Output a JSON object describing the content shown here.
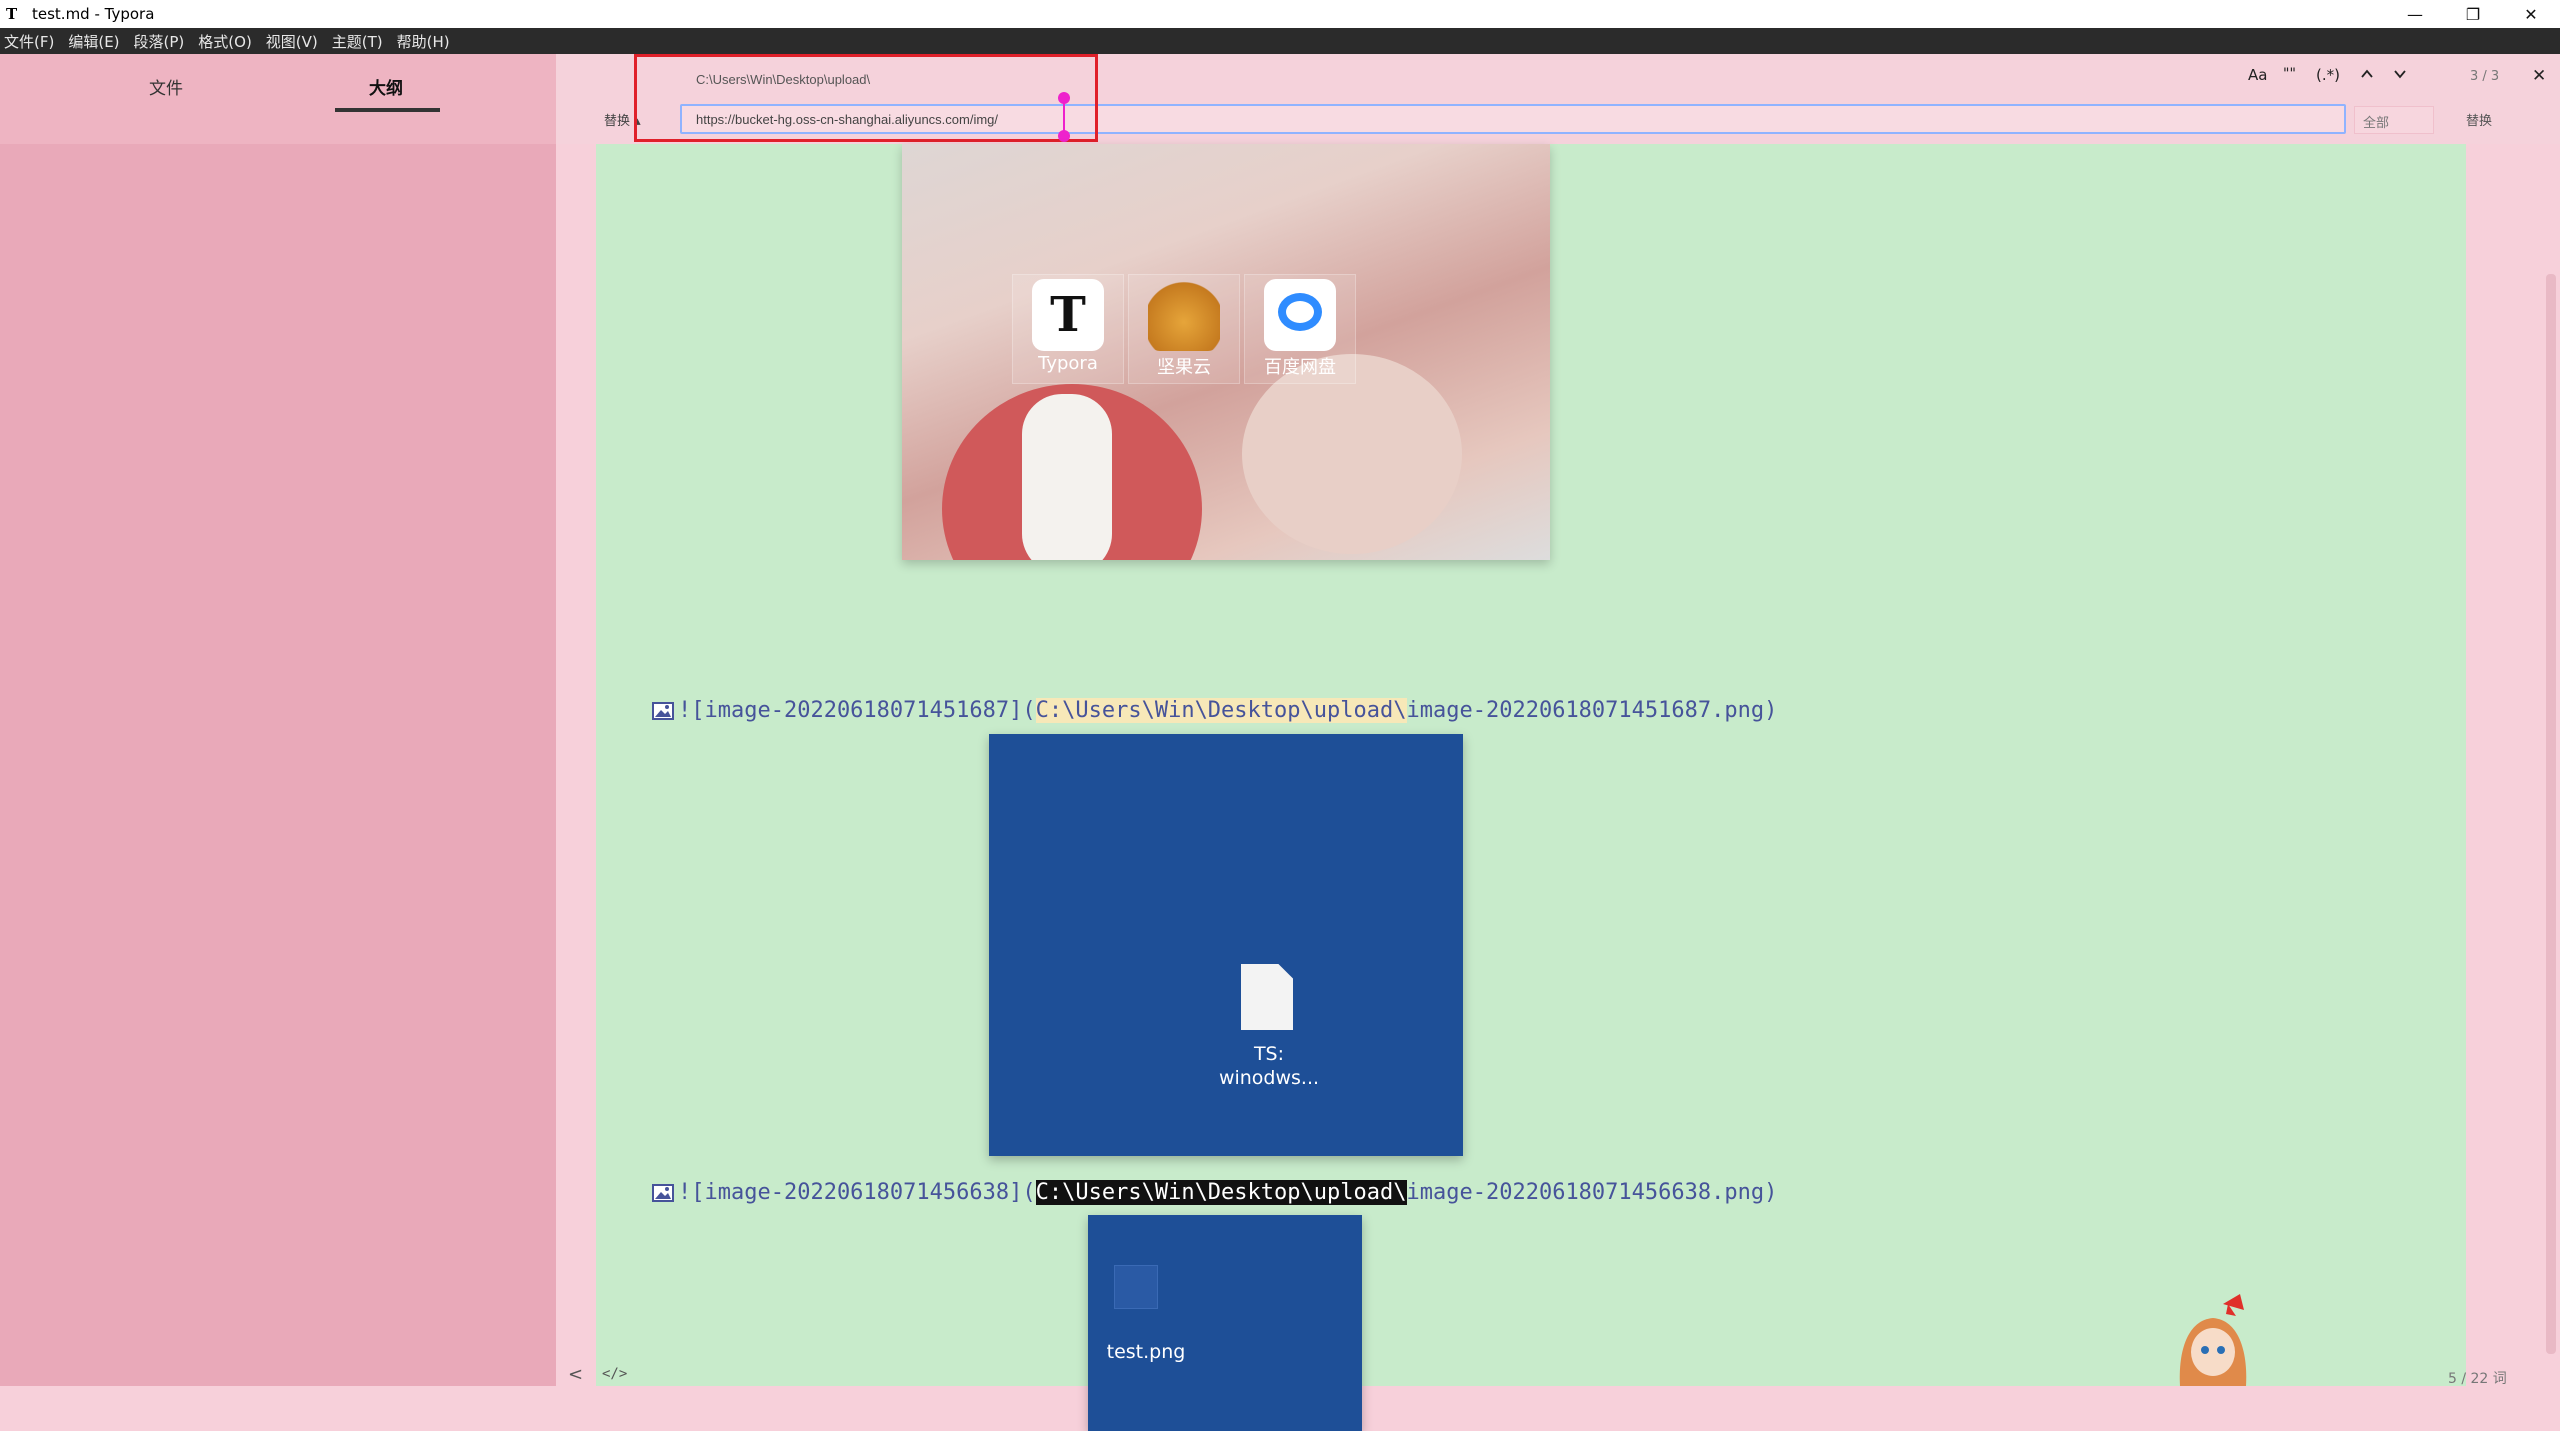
{
  "window": {
    "title": "test.md - Typora",
    "app_icon": "T",
    "buttons": {
      "minimize": "—",
      "restore": "❐",
      "close": "✕"
    }
  },
  "menu": [
    "文件(F)",
    "编辑(E)",
    "段落(P)",
    "格式(O)",
    "视图(V)",
    "主题(T)",
    "帮助(H)"
  ],
  "sidebar": {
    "tabs": [
      {
        "label": "文件",
        "active": false
      },
      {
        "label": "大纲",
        "active": true
      }
    ]
  },
  "find": {
    "search_value": "C:\\Users\\Win\\Desktop\\upload\\",
    "replace_value": "https://bucket-hg.oss-cn-shanghai.aliyuncs.com/img/",
    "options": {
      "case": "Aa",
      "word": "\"\"",
      "regex": "(.*)"
    },
    "prev_icon": "chevron-up-icon",
    "next_icon": "chevron-down-icon",
    "match_count": "3 / 3",
    "replace_toggle": "替换 ▴",
    "replace_all": "全部",
    "replace": "替换",
    "close": "✕"
  },
  "document": {
    "images": [
      {
        "icons": [
          {
            "label": "Typora",
            "glyph": "T"
          },
          {
            "label": "坚果云",
            "glyph": ""
          },
          {
            "label": "百度网盘",
            "glyph": ""
          }
        ]
      },
      {
        "line_prefix": "![image-20220618071451687](",
        "line_path": "C:\\Users\\Win\\Desktop\\upload\\",
        "line_suffix": "image-20220618071451687.png)",
        "file_label_1": "TS:",
        "file_label_2": "winodws..."
      },
      {
        "line_prefix": "![image-20220618071456638](",
        "line_path": "C:\\Users\\Win\\Desktop\\upload\\",
        "line_suffix": "image-20220618071456638.png)",
        "file_label": "test.png"
      }
    ]
  },
  "status": {
    "back": "<",
    "source_toggle": "</>",
    "word_count": "5 / 22 词"
  },
  "colors": {
    "sidebar_bg": "#e9a9b9",
    "editor_bg": "#f7d0da",
    "content_bg": "#c8ebcb",
    "annotation": "#e0202a",
    "link_text": "#46539a",
    "input_focus": "#8fb3ff"
  }
}
